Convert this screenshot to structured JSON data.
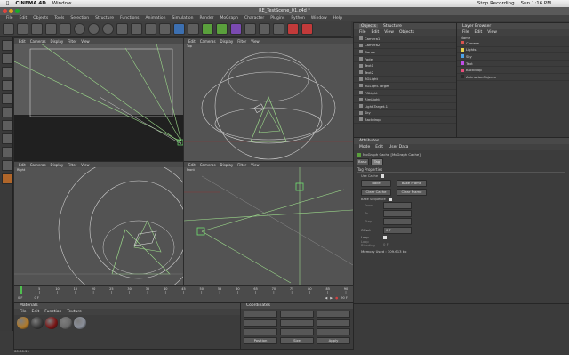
{
  "mac_menu": {
    "app": "CINEMA 4D",
    "window": "Window",
    "right_status": "Stop Recording",
    "clock": "Sun 1:16 PM"
  },
  "window_title": "RE_TestScene_01.c4d *",
  "main_menu": [
    "File",
    "Edit",
    "Objects",
    "Tools",
    "Selection",
    "Structure",
    "Functions",
    "Animation",
    "Simulation",
    "Render",
    "MoGraph",
    "Character",
    "Plugins",
    "Python",
    "Window",
    "Help"
  ],
  "viewports": [
    {
      "name": "Perspective",
      "menu": [
        "Edit",
        "Cameras",
        "Display",
        "Filter",
        "View"
      ]
    },
    {
      "name": "Top",
      "menu": [
        "Edit",
        "Cameras",
        "Display",
        "Filter",
        "View"
      ]
    },
    {
      "name": "Right",
      "menu": [
        "Edit",
        "Cameras",
        "Display",
        "Filter",
        "View"
      ]
    },
    {
      "name": "Front",
      "menu": [
        "Edit",
        "Cameras",
        "Display",
        "Filter",
        "View"
      ]
    }
  ],
  "objects_panel": {
    "tabs": [
      "Objects",
      "Structure"
    ],
    "menu": [
      "File",
      "Edit",
      "View",
      "Objects"
    ],
    "items": [
      "Camera1",
      "Camera2",
      "Dance",
      "Fade",
      "Text1",
      "Text2",
      "BGLight",
      "BGLight.Target",
      "FGLight",
      "RimLight",
      "Light.Target.1",
      "Sky",
      "Backdrop"
    ]
  },
  "layer_browser": {
    "title": "Layer Browser",
    "menu": [
      "File",
      "Edit",
      "View"
    ],
    "header": "Name",
    "layers": [
      {
        "name": "Camera",
        "color": "#d9534f"
      },
      {
        "name": "Lights",
        "color": "#e8d44d"
      },
      {
        "name": "Sky",
        "color": "#4da3e8"
      },
      {
        "name": "Text",
        "color": "#c04de8"
      },
      {
        "name": "Backdrop",
        "color": "#e84d7a"
      },
      {
        "name": "AnimationObjects",
        "color": "#2a2a2a"
      }
    ]
  },
  "attributes": {
    "title": "Attributes",
    "menu": [
      "Mode",
      "Edit",
      "User Data"
    ],
    "object_label": "MoGraph Cache [MoGraph Cache]",
    "tabs": [
      "Basic",
      "Tag"
    ],
    "section": "Tag Properties",
    "use_cache_label": "Use Cache",
    "buttons": [
      "Bake",
      "Bake Frame",
      "Clear Cache",
      "Clear Frame"
    ],
    "bake_sequence_label": "Bake Sequence",
    "fields": [
      "From",
      "To",
      "Step"
    ],
    "offset_label": "Offset",
    "offset_value": "0 F",
    "loop_label": "Loop",
    "loop_blending_label": "Loop Blending",
    "loop_blending_value": "0 F",
    "memory_label": "Memory Used : 309.613 kb"
  },
  "timeline": {
    "ticks": [
      "0",
      "5",
      "10",
      "15",
      "20",
      "25",
      "30",
      "35",
      "40",
      "45",
      "50",
      "55",
      "60",
      "65",
      "70",
      "75",
      "80",
      "85",
      "90"
    ],
    "start": "0 F",
    "end": "90 F",
    "current": "0 F"
  },
  "materials": {
    "title": "Materials",
    "menu": [
      "File",
      "Edit",
      "Function",
      "Texture"
    ],
    "swatches": [
      "#b07a2a",
      "#3a3a3a",
      "#7a1515",
      "#6a6a6a",
      "#8a8f9a"
    ]
  },
  "coordinates": {
    "title": "Coordinates",
    "labels": [
      "Position",
      "Size",
      "Rotation"
    ],
    "apply_label": "Apply"
  },
  "status_time": "00:00:21"
}
